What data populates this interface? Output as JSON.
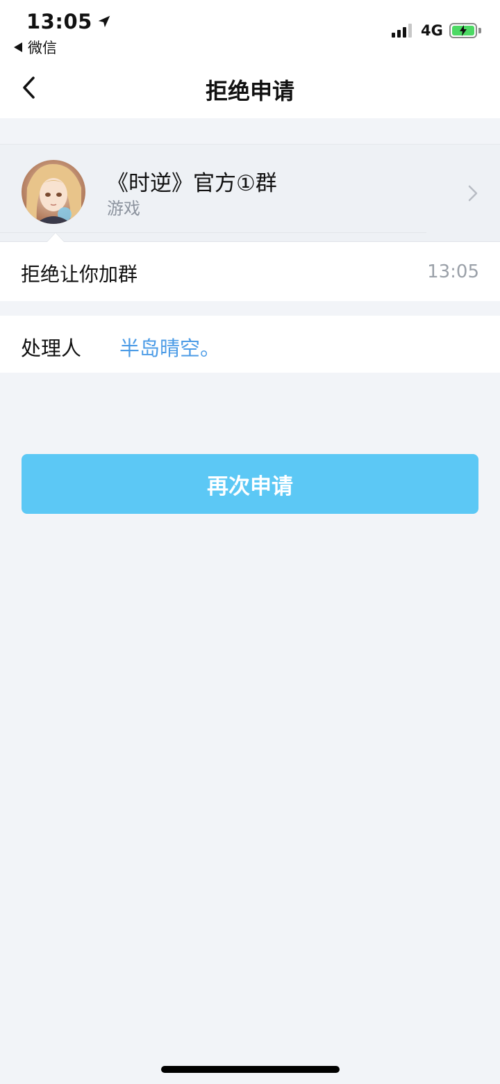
{
  "status_bar": {
    "time": "13:05",
    "back_app": "微信",
    "network": "4G"
  },
  "nav": {
    "title": "拒绝申请",
    "back_icon": "chevron-left-icon"
  },
  "group": {
    "name": "《时逆》官方①群",
    "tag": "游戏",
    "chevron_icon": "chevron-right-icon"
  },
  "message": {
    "text": "拒绝让你加群",
    "time": "13:05"
  },
  "handler": {
    "label": "处理人",
    "name": "半岛晴空。"
  },
  "actions": {
    "reapply_label": "再次申请"
  },
  "colors": {
    "accent": "#5cc8f5",
    "link": "#4b9be6",
    "background": "#f2f4f8"
  }
}
